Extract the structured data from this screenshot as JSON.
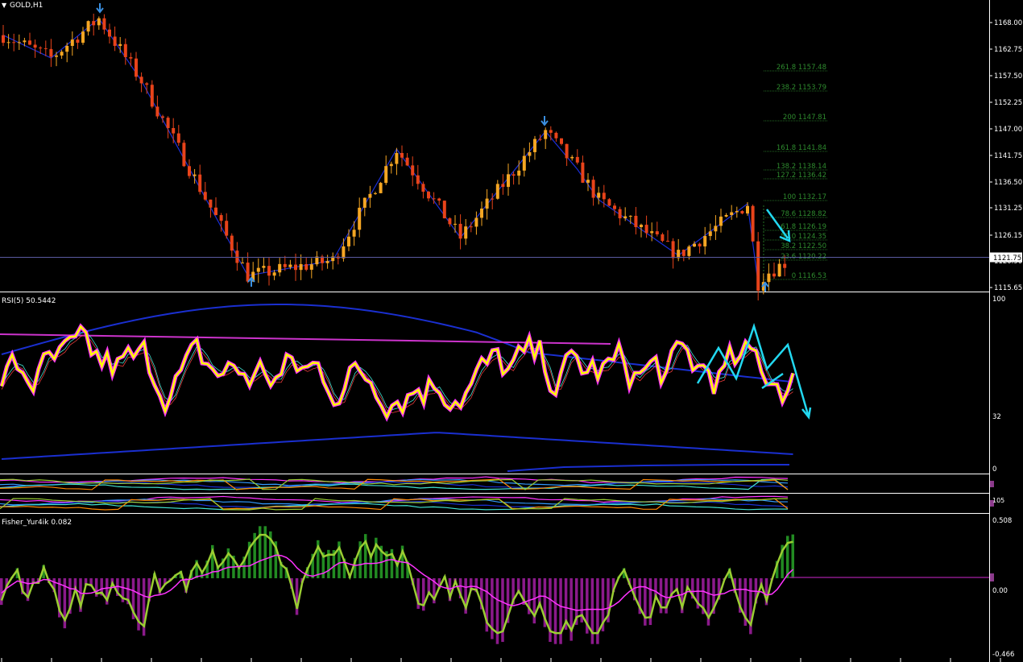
{
  "colors": {
    "background": "#000000",
    "bull": "#f5a623",
    "bear": "#e8431a",
    "zigzag": "#1c2fd6",
    "arrow": "#3a8fe0",
    "fib": "#2e8b2e",
    "hline": "#5a5aa0",
    "price_tag_bg": "#ffffff",
    "rsi_main": "#ffff00",
    "rsi_glow": "#ff33ff",
    "rsi_signal": "#40e0d0",
    "rsi_fast": "#ff4040",
    "band": "#1a2fd0",
    "level_magenta": "#cc33cc",
    "cyan_draw": "#22d8f0",
    "fisher_line": "#9acd32",
    "fisher_signal": "#ff33ff",
    "fisher_pos": "#228b22",
    "fisher_neg": "#8b1a8b",
    "axis_text": "#ffffff",
    "separator": "#ffffff"
  },
  "header": {
    "symbol": "GOLD,H1",
    "rsi_label": "RSI(5) 50.5442",
    "fisher_label": "Fisher_Yur4ik 0.082",
    "mini_label": "105"
  },
  "price_axis": {
    "ticks": [
      "1168.00",
      "1162.75",
      "1157.50",
      "1152.25",
      "1147.00",
      "1141.75",
      "1136.50",
      "1131.25",
      "1126.15",
      "1120.90",
      "1115.65"
    ],
    "current_price": "1121.75"
  },
  "rsi_axis": {
    "ticks": [
      "100",
      "32",
      "0"
    ]
  },
  "fisher_axis": {
    "ticks": [
      "0.508",
      "0.00",
      "-0.466"
    ]
  },
  "fib_levels": [
    {
      "label": "261.8 1157.48"
    },
    {
      "label": "238.2 1153.79"
    },
    {
      "label": "200 1147.81"
    },
    {
      "label": "161.8 1141.84"
    },
    {
      "label": "138.2 1138.14"
    },
    {
      "label": "127.2 1136.42"
    },
    {
      "label": "100 1132.17"
    },
    {
      "label": "78.6 1128.82"
    },
    {
      "label": "61.8 1126.19"
    },
    {
      "label": "50.0 1124.35"
    },
    {
      "label": "38.2 1122.50"
    },
    {
      "label": "23.6 1120.22"
    },
    {
      "label": "0 1116.53"
    }
  ],
  "chart_data": {
    "type": "candlestick",
    "title": "GOLD,H1",
    "ylim": [
      1114.0,
      1170.0
    ],
    "zigzag_pivots": [
      [
        0,
        1165.5
      ],
      [
        9,
        1161.0
      ],
      [
        18,
        1168.8
      ],
      [
        26,
        1156.5
      ],
      [
        46,
        1118.0
      ],
      [
        62,
        1121.0
      ],
      [
        74,
        1143.0
      ],
      [
        86,
        1125.5
      ],
      [
        102,
        1146.5
      ],
      [
        108,
        1139.0
      ],
      [
        112,
        1133.0
      ],
      [
        127,
        1122.0
      ],
      [
        140,
        1132.2
      ],
      [
        142,
        1116.5
      ]
    ],
    "fisher_range": [
      -0.466,
      0.508
    ],
    "rsi_range": [
      0,
      100
    ]
  }
}
